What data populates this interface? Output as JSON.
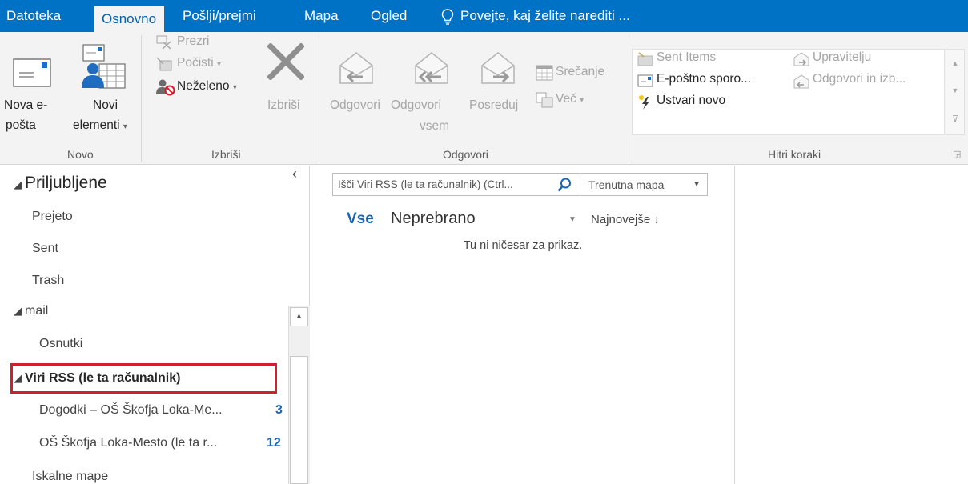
{
  "tabs": [
    {
      "label": "Datoteka"
    },
    {
      "label": "Osnovno"
    },
    {
      "label": "Pošlji/prejmi"
    },
    {
      "label": "Mapa"
    },
    {
      "label": "Ogled"
    }
  ],
  "tell_me": "Povejte, kaj želite narediti ...",
  "ribbon": {
    "novo": {
      "group_label": "Novo",
      "new_email_line1": "Nova e-",
      "new_email_line2": "pošta",
      "new_items_line1": "Novi",
      "new_items_line2": "elementi"
    },
    "izbrisi": {
      "group_label": "Izbriši",
      "ignore": "Prezri",
      "clean_up": "Počisti",
      "junk": "Neželeno",
      "delete": "Izbriši"
    },
    "odgovori": {
      "group_label": "Odgovori",
      "reply": "Odgovori",
      "reply_all_line1": "Odgovori",
      "reply_all_line2": "vsem",
      "forward": "Posreduj",
      "meeting": "Srečanje",
      "more": "Več"
    },
    "hitri_koraki": {
      "group_label": "Hitri koraki",
      "items": [
        "Sent Items",
        "Upravitelju",
        "E-poštno sporo...",
        "Odgovori in izb...",
        "Ustvari novo"
      ]
    }
  },
  "folders": {
    "favorites_header": "Priljubljene",
    "favorites": [
      "Prejeto",
      "Sent",
      "Trash"
    ],
    "mail_header": "mail",
    "mail_items": [
      "Osnutki"
    ],
    "rss_header": "Viri RSS (le ta računalnik)",
    "rss_items": [
      {
        "label": "Dogodki – OŠ Škofja Loka-Me...",
        "count": "3"
      },
      {
        "label": "OŠ Škofja Loka-Mesto (le ta r...",
        "count": "12"
      }
    ],
    "search_folders": "Iskalne mape"
  },
  "message_list": {
    "search_placeholder": "Išči Viri RSS (le ta računalnik) (Ctrl...",
    "scope": "Trenutna mapa",
    "filter_all": "Vse",
    "filter_unread": "Neprebrano",
    "sort": "Najnovejše",
    "empty_text": "Tu ni ničesar za prikaz."
  },
  "colors": {
    "accent": "#0072c6",
    "highlight_box": "#d1202d",
    "count_blue": "#1d64b0"
  }
}
